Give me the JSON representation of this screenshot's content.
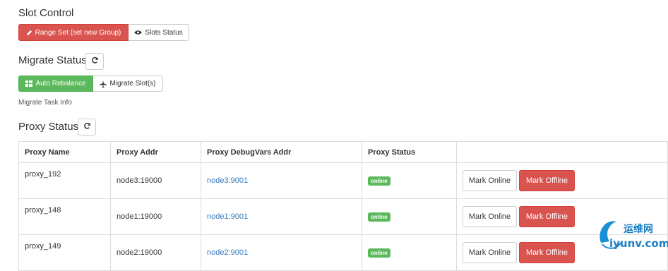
{
  "slot_control": {
    "title": "Slot Control",
    "range_set_label": "Range Set (set new Group)",
    "slots_status_label": "Slots Status"
  },
  "migrate": {
    "title": "Migrate Status",
    "auto_rebalance_label": "Auto Rebalance",
    "migrate_slots_label": "Migrate Slot(s)",
    "task_info": "Migrate Task Info"
  },
  "proxy": {
    "title": "Proxy Status",
    "headers": [
      "Proxy Name",
      "Proxy Addr",
      "Proxy DebugVars Addr",
      "Proxy Status",
      ""
    ],
    "rows": [
      {
        "name": "proxy_192",
        "addr": "node3:19000",
        "debug": "node3:9001",
        "status": "online"
      },
      {
        "name": "proxy_148",
        "addr": "node1:19000",
        "debug": "node1:9001",
        "status": "online"
      },
      {
        "name": "proxy_149",
        "addr": "node2:19000",
        "debug": "node2:9001",
        "status": "online"
      }
    ],
    "mark_online_label": "Mark Online",
    "mark_offline_label": "Mark Offline"
  },
  "watermark": {
    "cn_text": "运维网",
    "domain": "iyunv.com"
  },
  "colors": {
    "danger": "#d9534f",
    "success": "#5cb85c",
    "link": "#337ab7"
  }
}
